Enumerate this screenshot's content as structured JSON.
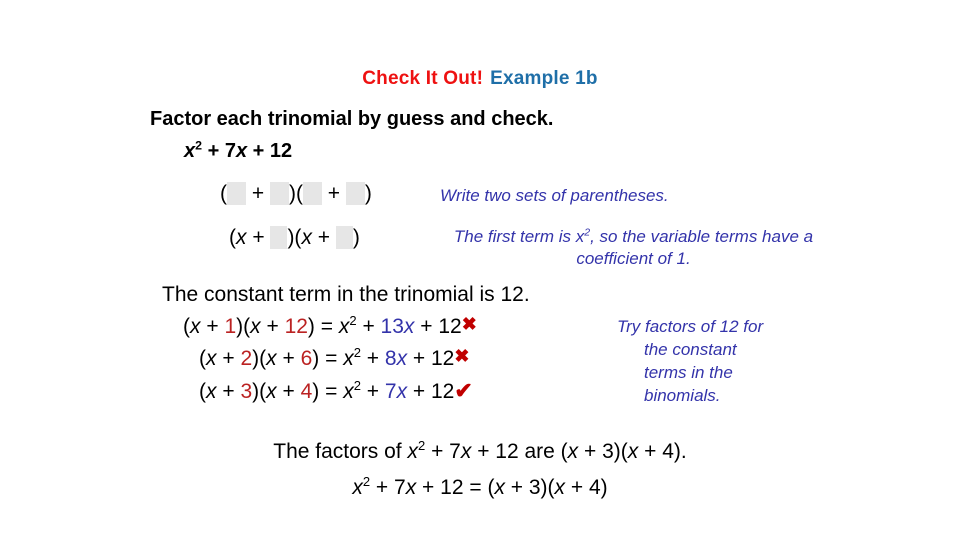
{
  "title": {
    "part_red": "Check It Out!",
    "part_blue": "Example 1b"
  },
  "prompt": {
    "instruction": "Factor each trinomial by guess and check.",
    "expression_base": "x",
    "expression_exp": "2",
    "expression_rest": " + 7x + 12"
  },
  "steps": {
    "row1": {
      "open1": "(",
      "plus1": "+",
      "close1": ")",
      "open2": "(",
      "plus2": "+",
      "close2": ")"
    },
    "row2": {
      "text_a": "(x + ",
      "text_b": ")(x + ",
      "text_c": ")"
    }
  },
  "notes": {
    "note1": "Write two sets of parentheses.",
    "note2_a": "The first term is x",
    "note2_exp": "2",
    "note2_b": ", so the variable terms have a coefficient of 1.",
    "note3_line1": "Try factors of 12 for",
    "note3_line2": "the constant",
    "note3_line3": "terms in the",
    "note3_line4": "binomials."
  },
  "constant_line": "The constant term in the trinomial is 12.",
  "attempts": [
    {
      "lead": "(x + ",
      "f1": "1",
      "mid": ")(x + ",
      "f2": "12",
      "eq": ") = x",
      "exp": "2",
      "plus": " + ",
      "coeff": "13x",
      "tail": " + 12",
      "mark": "✖",
      "mark_type": "cross"
    },
    {
      "lead": "(x + ",
      "f1": "2",
      "mid": ")(x + ",
      "f2": "6",
      "eq": ") = x",
      "exp": "2",
      "plus": " + ",
      "coeff": "8x",
      "tail": " + 12",
      "mark": "✖",
      "mark_type": "cross"
    },
    {
      "lead": "(x + ",
      "f1": "3",
      "mid": ")(x + ",
      "f2": "4",
      "eq": ") = x",
      "exp": "2",
      "plus": " + ",
      "coeff": "7x",
      "tail": " + 12",
      "mark": "✔",
      "mark_type": "check"
    }
  ],
  "conclusion": {
    "line1_a": "The factors of x",
    "line1_exp": "2",
    "line1_b": " + 7x + 12 are (x + 3)(x + 4).",
    "line2_a": "x",
    "line2_exp": "2",
    "line2_b": " + 7x + 12 = (x + 3)(x + 4)"
  },
  "colors": {
    "title_red": "#ee1111",
    "title_blue": "#1f6fa8",
    "note_blue": "#3333aa",
    "factor_red": "#bb2222",
    "mark_red": "#c00000",
    "blank_gray": "#e6e6e6"
  }
}
